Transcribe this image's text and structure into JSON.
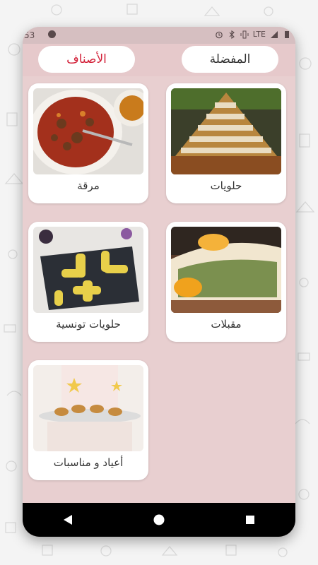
{
  "status": {
    "time": "53",
    "network": "LTE"
  },
  "tabs": {
    "favorites": "المفضلة",
    "categories": "الأصناف"
  },
  "categories": [
    {
      "name": "حلويات"
    },
    {
      "name": "مرقة"
    },
    {
      "name": "مقبلات"
    },
    {
      "name": "حلويات تونسية"
    },
    {
      "name": "أعياد و مناسبات"
    }
  ],
  "colors": {
    "active_tab": "#d3223a",
    "background": "#e8cfd0",
    "statusbar": "#d6bfc1"
  }
}
